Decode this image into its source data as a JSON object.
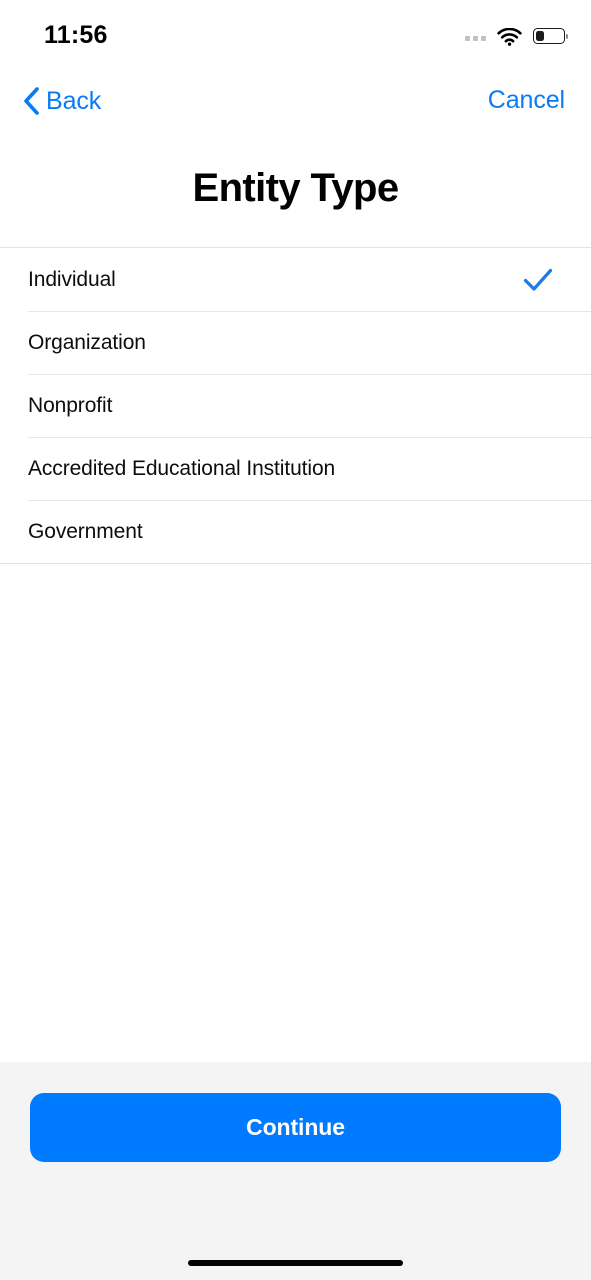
{
  "status_bar": {
    "time": "11:56",
    "signal_icon": "signal-dots-icon",
    "wifi_icon": "wifi-icon",
    "battery_icon": "battery-icon",
    "battery_level_percent": 30
  },
  "nav": {
    "back_label": "Back",
    "back_icon": "chevron-left-icon",
    "cancel_label": "Cancel",
    "accent_color": "#0b7bf4"
  },
  "header": {
    "title": "Entity Type"
  },
  "options": {
    "selected_index": 0,
    "check_icon": "checkmark-icon",
    "check_color": "#1a7ae8",
    "items": [
      {
        "label": "Individual",
        "selected": true
      },
      {
        "label": "Organization",
        "selected": false
      },
      {
        "label": "Nonprofit",
        "selected": false
      },
      {
        "label": "Accredited Educational Institution",
        "selected": false
      },
      {
        "label": "Government",
        "selected": false
      }
    ]
  },
  "footer": {
    "continue_label": "Continue",
    "button_color": "#007aff",
    "background_color": "#f4f4f5",
    "home_indicator": "home-indicator"
  }
}
